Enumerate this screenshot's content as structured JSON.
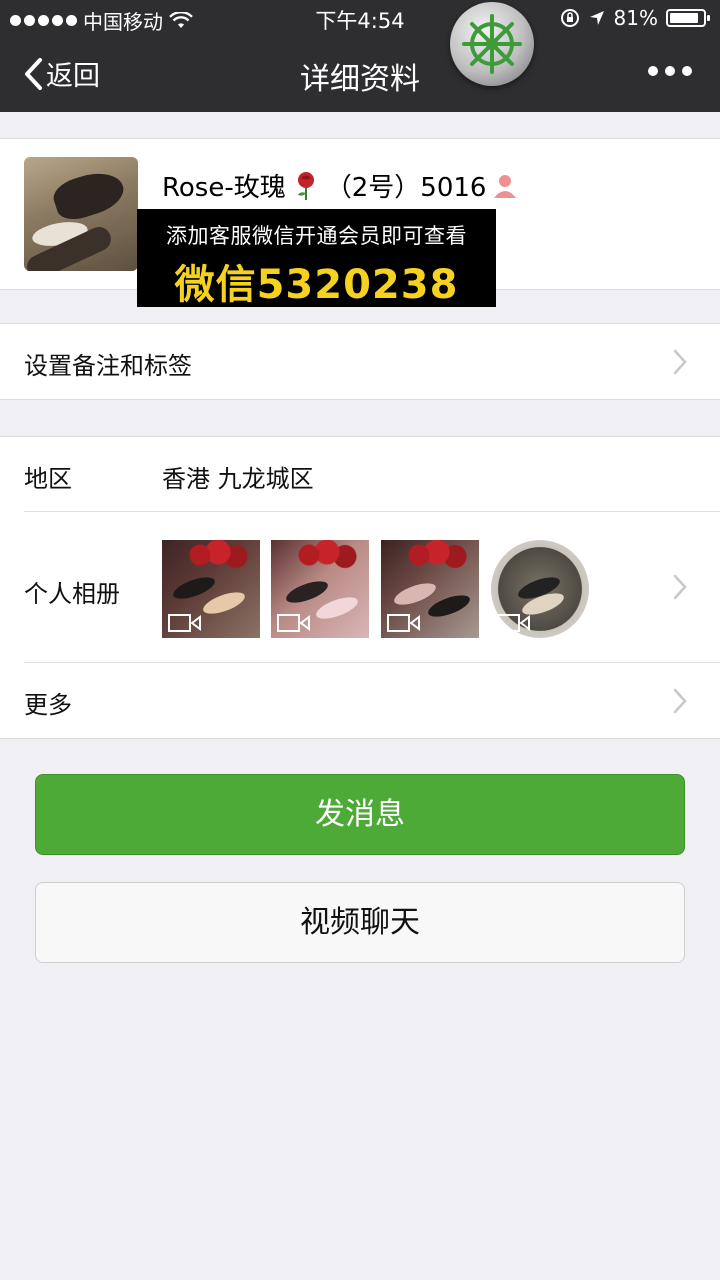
{
  "status_bar": {
    "carrier": "中国移动",
    "time": "下午4:54",
    "battery": "81%"
  },
  "nav": {
    "back_label": "返回",
    "title": "详细资料"
  },
  "profile": {
    "name": "Rose-玫瑰",
    "name_suffix": "（2号）5016"
  },
  "overlay": {
    "line1": "添加客服微信开通会员即可查看",
    "line2": "微信5320238"
  },
  "rows": {
    "remark": "设置备注和标签",
    "region_label": "地区",
    "region_value": "香港 九龙城区",
    "album_label": "个人相册",
    "more_label": "更多"
  },
  "buttons": {
    "send_message": "发消息",
    "video_chat": "视频聊天"
  },
  "colors": {
    "primary_green": "#4eaa36",
    "nav_bg": "#2e2e31",
    "overlay_yellow": "#f5d220"
  }
}
